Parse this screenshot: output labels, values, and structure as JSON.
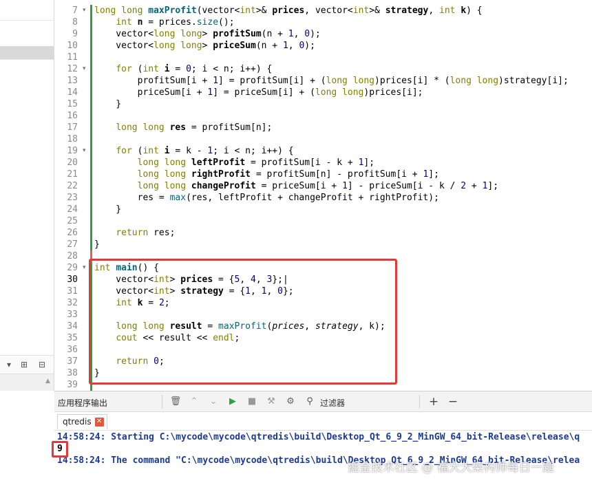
{
  "sidebar": {
    "toolbar_icons": [
      "dropdown-arrow",
      "split-add",
      "split-close"
    ],
    "toolbar_labels": [
      "▾",
      "⊞",
      "⊟"
    ]
  },
  "editor": {
    "current_line": 30,
    "lines": [
      {
        "n": 7,
        "fold": true,
        "html": "<span class=\"kw\">long long</span> <span class=\"fnb\">maxProfit</span>(vector&lt;<span class=\"kw\">int</span>&gt;&amp; <span class=\"var\">prices</span>, vector&lt;<span class=\"kw\">int</span>&gt;&amp; <span class=\"var\">strategy</span>, <span class=\"kw\">int</span> <span class=\"var\">k</span>) {"
      },
      {
        "n": 8,
        "html": "    <span class=\"kw\">int</span> <span class=\"var\">n</span> = prices.<span class=\"fn\">size</span>();"
      },
      {
        "n": 9,
        "html": "    vector&lt;<span class=\"kw\">long long</span>&gt; <span class=\"var\">profitSum</span>(n + <span class=\"num\">1</span>, <span class=\"num\">0</span>);"
      },
      {
        "n": 10,
        "html": "    vector&lt;<span class=\"kw\">long long</span>&gt; <span class=\"var\">priceSum</span>(n + <span class=\"num\">1</span>, <span class=\"num\">0</span>);"
      },
      {
        "n": 11,
        "html": ""
      },
      {
        "n": 12,
        "fold": true,
        "html": "    <span class=\"kw\">for</span> (<span class=\"kw\">int</span> <span class=\"var\">i</span> = <span class=\"num\">0</span>; i &lt; n; i++) {"
      },
      {
        "n": 13,
        "html": "        profitSum[i + <span class=\"num\">1</span>] = profitSum[i] + (<span class=\"kw\">long long</span>)prices[i] * (<span class=\"kw\">long long</span>)strategy[i];"
      },
      {
        "n": 14,
        "html": "        priceSum[i + <span class=\"num\">1</span>] = priceSum[i] + (<span class=\"kw\">long long</span>)prices[i];"
      },
      {
        "n": 15,
        "html": "    }"
      },
      {
        "n": 16,
        "html": ""
      },
      {
        "n": 17,
        "html": "    <span class=\"kw\">long long</span> <span class=\"var\">res</span> = profitSum[n];"
      },
      {
        "n": 18,
        "html": ""
      },
      {
        "n": 19,
        "fold": true,
        "html": "    <span class=\"kw\">for</span> (<span class=\"kw\">int</span> <span class=\"var\">i</span> = k - <span class=\"num\">1</span>; i &lt; n; i++) {"
      },
      {
        "n": 20,
        "html": "        <span class=\"kw\">long long</span> <span class=\"var\">leftProfit</span> = profitSum[i - k + <span class=\"num\">1</span>];"
      },
      {
        "n": 21,
        "html": "        <span class=\"kw\">long long</span> <span class=\"var\">rightProfit</span> = profitSum[n] - profitSum[i + <span class=\"num\">1</span>];"
      },
      {
        "n": 22,
        "html": "        <span class=\"kw\">long long</span> <span class=\"var\">changeProfit</span> = priceSum[i + <span class=\"num\">1</span>] - priceSum[i - k / <span class=\"num\">2</span> + <span class=\"num\">1</span>];"
      },
      {
        "n": 23,
        "html": "        res = <span class=\"fn\">max</span>(res, leftProfit + changeProfit + rightProfit);"
      },
      {
        "n": 24,
        "html": "    }"
      },
      {
        "n": 25,
        "html": ""
      },
      {
        "n": 26,
        "html": "    <span class=\"kw\">return</span> res;"
      },
      {
        "n": 27,
        "html": "}"
      },
      {
        "n": 28,
        "html": ""
      },
      {
        "n": 29,
        "fold": true,
        "html": "<span class=\"kw\">int</span> <span class=\"fnb\">main</span>() {"
      },
      {
        "n": 30,
        "html": "    vector&lt;<span class=\"kw\">int</span>&gt; <span class=\"var\">prices</span> = {<span class=\"num\">5</span>, <span class=\"num\">4</span>, <span class=\"num\">3</span>};|"
      },
      {
        "n": 31,
        "html": "    vector&lt;<span class=\"kw\">int</span>&gt; <span class=\"var\">strategy</span> = {<span class=\"num\">1</span>, <span class=\"num\">1</span>, <span class=\"num\">0</span>};"
      },
      {
        "n": 32,
        "html": "    <span class=\"kw\">int</span> <span class=\"var\">k</span> = <span class=\"num\">2</span>;"
      },
      {
        "n": 33,
        "html": ""
      },
      {
        "n": 34,
        "html": "    <span class=\"kw\">long long</span> <span class=\"var\">result</span> = <span class=\"fn\">maxProfit</span>(<span class=\"it\">prices</span>, <span class=\"it\">strategy</span>, k);"
      },
      {
        "n": 35,
        "html": "    <span class=\"kw\">cout</span> &lt;&lt; result &lt;&lt; <span class=\"kw\">endl</span>;"
      },
      {
        "n": 36,
        "html": ""
      },
      {
        "n": 37,
        "html": "    <span class=\"kw\">return</span> <span class=\"num\">0</span>;"
      },
      {
        "n": 38,
        "html": "}"
      },
      {
        "n": 39,
        "html": ""
      }
    ]
  },
  "output_pane": {
    "title": "应用程序输出",
    "filter_label": "过滤器",
    "tab_label": "qtredis",
    "tab_close": "✕",
    "toolbar_glyphs": {
      "clear": "🗑",
      "up": "⌃",
      "down": "⌄",
      "run": "▶",
      "stop": "■",
      "build": "⚒",
      "settings": "⚙",
      "search": "⚲",
      "add": "+",
      "remove": "−"
    },
    "lines": [
      "14:58:24: Starting C:\\mycode\\mycode\\qtredis\\build\\Desktop_Qt_6_9_2_MinGW_64_bit-Release\\release\\q",
      "14:58:24: The command \"C:\\mycode\\mycode\\qtredis\\build\\Desktop_Qt_6_9_2_MinGW_64_bit-Release\\relea"
    ],
    "result": "9"
  },
  "watermark": "掘金技术社区 @ 福大大架构师每日一题",
  "colors": {
    "accent_red": "#e03a3a",
    "change_green": "#2ea043",
    "change_red": "#e06060",
    "keyword": "#808000",
    "output_blue": "#1a3a9a"
  }
}
